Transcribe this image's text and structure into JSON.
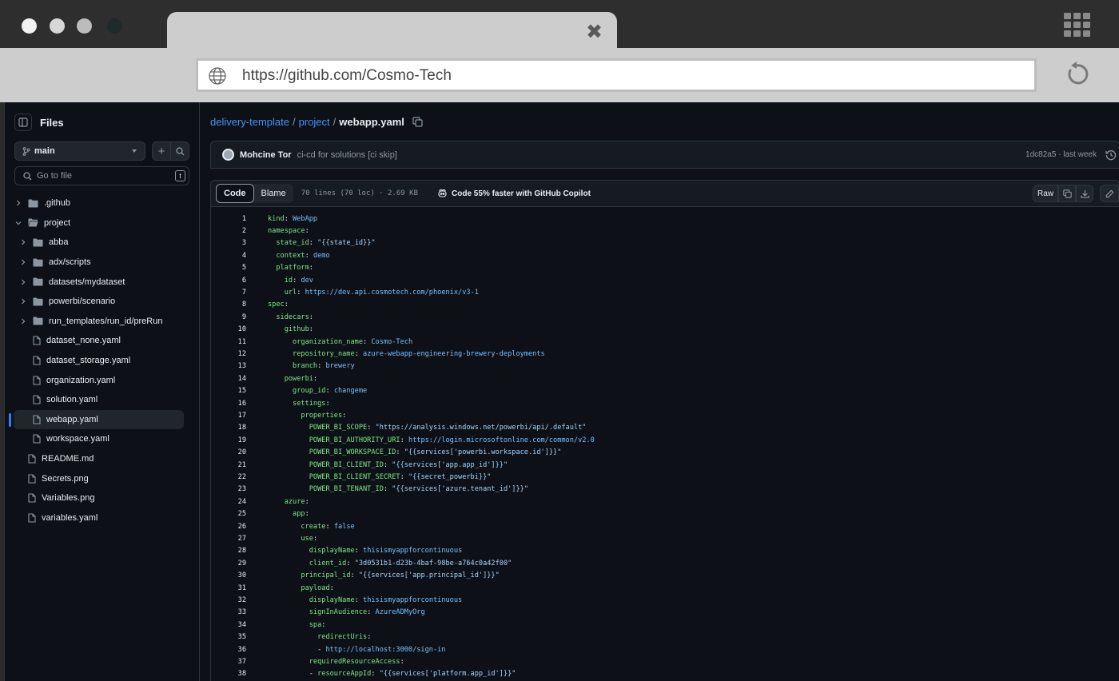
{
  "browser": {
    "url": "https://github.com/Cosmo-Tech",
    "tab_close": "✖"
  },
  "sidebar": {
    "title": "Files",
    "branch": "main",
    "goto_placeholder": "Go to file",
    "goto_shortcut": "t",
    "tree": [
      {
        "label": ".github",
        "type": "folder",
        "depth": 0,
        "expanded": false
      },
      {
        "label": "project",
        "type": "folder",
        "depth": 0,
        "expanded": true
      },
      {
        "label": "abba",
        "type": "folder",
        "depth": 1,
        "expanded": false
      },
      {
        "label": "adx/scripts",
        "type": "folder",
        "depth": 1,
        "expanded": false
      },
      {
        "label": "datasets/mydataset",
        "type": "folder",
        "depth": 1,
        "expanded": false
      },
      {
        "label": "powerbi/scenario",
        "type": "folder",
        "depth": 1,
        "expanded": false
      },
      {
        "label": "run_templates/run_id/preRun",
        "type": "folder",
        "depth": 1,
        "expanded": false
      },
      {
        "label": "dataset_none.yaml",
        "type": "file",
        "depth": 1
      },
      {
        "label": "dataset_storage.yaml",
        "type": "file",
        "depth": 1
      },
      {
        "label": "organization.yaml",
        "type": "file",
        "depth": 1
      },
      {
        "label": "solution.yaml",
        "type": "file",
        "depth": 1
      },
      {
        "label": "webapp.yaml",
        "type": "file",
        "depth": 1,
        "selected": true
      },
      {
        "label": "workspace.yaml",
        "type": "file",
        "depth": 1
      },
      {
        "label": "README.md",
        "type": "file",
        "depth": 0
      },
      {
        "label": "Secrets.png",
        "type": "file",
        "depth": 0
      },
      {
        "label": "Variables.png",
        "type": "file",
        "depth": 0
      },
      {
        "label": "variables.yaml",
        "type": "file",
        "depth": 0
      }
    ]
  },
  "breadcrumb": {
    "repo": "delivery-template",
    "folder": "project",
    "sep": "/",
    "file": "webapp.yaml"
  },
  "commit": {
    "author": "Mohcine Tor",
    "message": "ci-cd for solutions [ci skip]",
    "meta": "1dc82a5 · last week"
  },
  "file_header": {
    "tab_code": "Code",
    "tab_blame": "Blame",
    "info": "70 lines (70 loc) · 2.69 KB",
    "copilot": "Code 55% faster with GitHub Copilot",
    "raw_label": "Raw"
  },
  "code_lines": [
    {
      "n": "1",
      "indent": "",
      "key": "kind",
      "val": "WebApp",
      "vt": "v"
    },
    {
      "n": "2",
      "indent": "",
      "key": "namespace",
      "val": "",
      "vt": "v"
    },
    {
      "n": "3",
      "indent": "  ",
      "key": "state_id",
      "val": "\"{{state_id}}\"",
      "vt": "s"
    },
    {
      "n": "4",
      "indent": "  ",
      "key": "context",
      "val": "demo",
      "vt": "v"
    },
    {
      "n": "5",
      "indent": "  ",
      "key": "platform",
      "val": "",
      "vt": "v"
    },
    {
      "n": "6",
      "indent": "    ",
      "key": "id",
      "val": "dev",
      "vt": "v"
    },
    {
      "n": "7",
      "indent": "    ",
      "key": "url",
      "val": "https://dev.api.cosmotech.com/phoenix/v3-1",
      "vt": "v"
    },
    {
      "n": "8",
      "indent": "",
      "key": "spec",
      "val": "",
      "vt": "v"
    },
    {
      "n": "9",
      "indent": "  ",
      "key": "sidecars",
      "val": "",
      "vt": "v"
    },
    {
      "n": "10",
      "indent": "    ",
      "key": "github",
      "val": "",
      "vt": "v"
    },
    {
      "n": "11",
      "indent": "      ",
      "key": "organization_name",
      "val": "Cosmo-Tech",
      "vt": "v"
    },
    {
      "n": "12",
      "indent": "      ",
      "key": "repository_name",
      "val": "azure-webapp-engineering-brewery-deployments",
      "vt": "v"
    },
    {
      "n": "13",
      "indent": "      ",
      "key": "branch",
      "val": "brewery",
      "vt": "v"
    },
    {
      "n": "14",
      "indent": "    ",
      "key": "powerbi",
      "val": "",
      "vt": "v"
    },
    {
      "n": "15",
      "indent": "      ",
      "key": "group_id",
      "val": "changeme",
      "vt": "v"
    },
    {
      "n": "16",
      "indent": "      ",
      "key": "settings",
      "val": "",
      "vt": "v"
    },
    {
      "n": "17",
      "indent": "        ",
      "key": "properties",
      "val": "",
      "vt": "v"
    },
    {
      "n": "18",
      "indent": "          ",
      "key": "POWER_BI_SCOPE",
      "val": "\"https://analysis.windows.net/powerbi/api/.default\"",
      "vt": "s"
    },
    {
      "n": "19",
      "indent": "          ",
      "key": "POWER_BI_AUTHORITY_URI",
      "val": "https://login.microsoftonline.com/common/v2.0",
      "vt": "v"
    },
    {
      "n": "20",
      "indent": "          ",
      "key": "POWER_BI_WORKSPACE_ID",
      "val": "\"{{services['powerbi.workspace.id']}}\"",
      "vt": "s"
    },
    {
      "n": "21",
      "indent": "          ",
      "key": "POWER_BI_CLIENT_ID",
      "val": "\"{{services['app.app_id']}}\"",
      "vt": "s"
    },
    {
      "n": "22",
      "indent": "          ",
      "key": "POWER_BI_CLIENT_SECRET",
      "val": "\"{{secret_powerbi}}\"",
      "vt": "s"
    },
    {
      "n": "23",
      "indent": "          ",
      "key": "POWER_BI_TENANT_ID",
      "val": "\"{{services['azure.tenant_id']}}\"",
      "vt": "s"
    },
    {
      "n": "24",
      "indent": "    ",
      "key": "azure",
      "val": "",
      "vt": "v"
    },
    {
      "n": "25",
      "indent": "      ",
      "key": "app",
      "val": "",
      "vt": "v"
    },
    {
      "n": "26",
      "indent": "        ",
      "key": "create",
      "val": "false",
      "vt": "v"
    },
    {
      "n": "27",
      "indent": "        ",
      "key": "use",
      "val": "",
      "vt": "v"
    },
    {
      "n": "28",
      "indent": "          ",
      "key": "displayName",
      "val": "thisismyappforcontinuous",
      "vt": "v"
    },
    {
      "n": "29",
      "indent": "          ",
      "key": "client_id",
      "val": "\"3d0531b1-d23b-4baf-98be-a764c0a42f00\"",
      "vt": "s"
    },
    {
      "n": "30",
      "indent": "        ",
      "key": "principal_id",
      "val": "\"{{services['app.principal_id']}}\"",
      "vt": "s"
    },
    {
      "n": "31",
      "indent": "        ",
      "key": "payload",
      "val": "",
      "vt": "v"
    },
    {
      "n": "32",
      "indent": "          ",
      "key": "displayName",
      "val": "thisismyappforcontinuous",
      "vt": "v"
    },
    {
      "n": "33",
      "indent": "          ",
      "key": "signInAudience",
      "val": "AzureADMyOrg",
      "vt": "v"
    },
    {
      "n": "34",
      "indent": "          ",
      "key": "spa",
      "val": "",
      "vt": "v"
    },
    {
      "n": "35",
      "indent": "            ",
      "key": "redirectUris",
      "val": "",
      "vt": "v"
    },
    {
      "n": "36",
      "indent": "            - ",
      "key": "",
      "val": "http://localhost:3000/sign-in",
      "vt": "v"
    },
    {
      "n": "37",
      "indent": "          ",
      "key": "requiredResourceAccess",
      "val": "",
      "vt": "v"
    },
    {
      "n": "38",
      "indent": "          - ",
      "key": "resourceAppId",
      "val": "\"{{services['platform.app_id']}}\"",
      "vt": "s"
    }
  ]
}
